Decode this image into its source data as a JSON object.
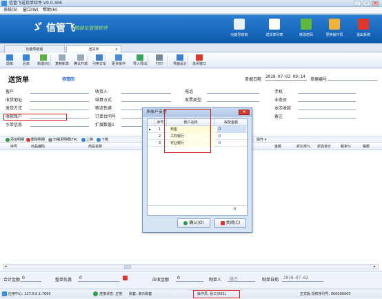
{
  "window": {
    "title": "信管飞送货单软件 V9.0.306",
    "min_label": "–",
    "max_label": "▫",
    "close_label": "✕"
  },
  "menu": [
    {
      "label": "系统(S)"
    },
    {
      "label": "窗口(W)"
    },
    {
      "label": "帮助(H)"
    }
  ],
  "banner": {
    "logo_mark": "ゞ",
    "logo_text": "信管飞",
    "slogan": "· 精细化管理软件",
    "buttons": [
      {
        "label": "功能导航窗",
        "icon": "monitor-icon",
        "color": "#e8f0fa"
      },
      {
        "label": "送货单列表",
        "icon": "list-icon",
        "color": "#ffffff"
      },
      {
        "label": "修改密码",
        "icon": "key-icon",
        "color": "#5fb83a"
      },
      {
        "label": "更换操作员",
        "icon": "user-icon",
        "color": "#f0b338"
      },
      {
        "label": "退出系统",
        "icon": "power-icon",
        "color": "#e0362c"
      }
    ]
  },
  "tabs": [
    {
      "label": "功能导航窗"
    },
    {
      "label": "送货单",
      "close": "✕"
    }
  ],
  "toolbar": [
    {
      "label": "前单",
      "icon": "prev-icon",
      "color": "#3b82d6"
    },
    {
      "label": "后单",
      "icon": "next-icon",
      "color": "#3b82d6"
    },
    {
      "label": "新增(N)",
      "icon": "add-icon",
      "color": "#5cae3f"
    },
    {
      "label": "复制新单",
      "icon": "copy-icon",
      "color": "#9aa8b8"
    },
    {
      "label": "确认开单",
      "icon": "confirm-icon",
      "color": "#9aa8b8"
    },
    {
      "label": "引用订单",
      "icon": "reference-icon",
      "color": "#3f7fd0"
    },
    {
      "label": "更多操作",
      "icon": "more-icon",
      "color": "#4a8ad8"
    },
    {
      "label": "导入导出",
      "icon": "import-export-icon",
      "color": "#3aa35c"
    },
    {
      "label": "打印",
      "icon": "print-icon",
      "color": "#7a8796"
    },
    {
      "label": "界面设计",
      "icon": "design-icon",
      "color": "#3d7ed2"
    },
    {
      "label": "关闭窗口",
      "icon": "close-window-icon",
      "color": "#d6392d"
    }
  ],
  "doc": {
    "title": "送货单",
    "status": "待签回",
    "date_label": "单据日期",
    "date_value": "2018-07-02 09:14",
    "no_label": "单据编号",
    "no_value": ""
  },
  "fields": {
    "col1": [
      "客户",
      "收货地址",
      "发货方式",
      "收款账户",
      "引单信息"
    ],
    "col2": [
      "收货人",
      "结算方式",
      "物流快递",
      "订单台同号",
      "扩展数值1"
    ],
    "col3": [
      "电话",
      "发票类型",
      "",
      "",
      ""
    ],
    "col4": [
      "手机",
      "业务员",
      "本次收款",
      "备注",
      ""
    ]
  },
  "subbar": [
    {
      "label": "添加明细",
      "color": "#2f9c4a"
    },
    {
      "label": "删除明细",
      "color": "#d6392d"
    },
    {
      "label": "扫描添明细(F4)",
      "color": "#888"
    },
    {
      "label": "上移",
      "color": "#3b82d6"
    },
    {
      "label": "下移",
      "color": "#3b82d6"
    }
  ],
  "subbar_more": "操作 ▾",
  "grid": {
    "headers": [
      {
        "label": "序号"
      },
      {
        "label": "商品编码"
      },
      {
        "label": "商品名称"
      },
      {
        "label": "金额"
      },
      {
        "label": "折扣率%"
      },
      {
        "label": "折后单价"
      },
      {
        "label": "税率%"
      },
      {
        "label": "税额"
      }
    ]
  },
  "footer": {
    "total_label": "合计金额",
    "total_value": "0",
    "discount_label": "整单优惠",
    "discount_value": "0",
    "due_label": "应收金额",
    "due_value": "0",
    "maker_label": "制单人",
    "maker_value": "张三",
    "date_label": "制单日期",
    "date_value": "2018-07-02"
  },
  "status": {
    "center": "应用中心: 127.0.0.1:7090",
    "conn": "连接状态: 正常",
    "book": "账套: 演示账套",
    "operator": "操作员: 张三(001)",
    "license": "正式版 授权序列号: 000000000"
  },
  "dialog": {
    "title": "多账户支付",
    "close": "✕",
    "headers": [
      "序号",
      "账户名称",
      "收款金额"
    ],
    "rows": [
      {
        "no": "1",
        "name": "现金",
        "amount": "0",
        "marker": "▶"
      },
      {
        "no": "2",
        "name": "工商银行",
        "amount": "0",
        "marker": ""
      },
      {
        "no": "3",
        "name": "农业银行",
        "amount": "0",
        "marker": ""
      }
    ],
    "total": "0",
    "ok_label": "确认(O)",
    "cancel_label": "关闭(C)"
  }
}
